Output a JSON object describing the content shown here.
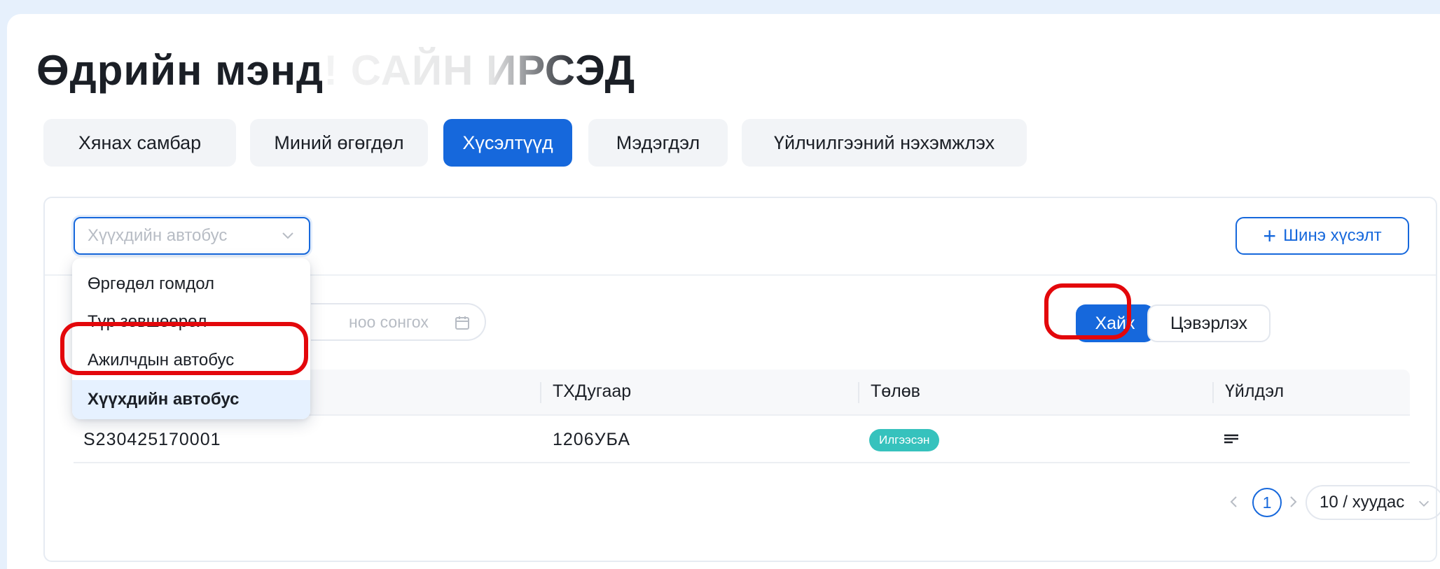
{
  "page": {
    "title_visible": "Өдрийн мэнд",
    "title_faded": "! САЙН ИРСЭ",
    "title_tail": "Д"
  },
  "tabs": [
    {
      "label": "Хянах самбар",
      "active": false
    },
    {
      "label": "Миний өгөгдөл",
      "active": false
    },
    {
      "label": "Хүсэлтүүд",
      "active": true
    },
    {
      "label": "Мэдэгдэл",
      "active": false
    },
    {
      "label": "Үйлчилгээний нэхэмжлэх",
      "active": false
    }
  ],
  "filters": {
    "type_select": {
      "placeholder": "Хүүхдийн автобус",
      "icon": "chevron-down-icon"
    },
    "date_field": {
      "placeholder": "ноо сонгох",
      "icon": "calendar-icon"
    },
    "search_label": "Хайх",
    "clear_label": "Цэвэрлэх"
  },
  "new_request": {
    "icon": "plus-icon",
    "label": "Шинэ хүсэлт"
  },
  "dropdown": {
    "options": [
      {
        "label": "Өргөдөл гомдол",
        "selected": false,
        "highlighted": false
      },
      {
        "label": "Түр зөвшөөрөл",
        "selected": false,
        "highlighted": false
      },
      {
        "label": "Ажилчдын автобус",
        "selected": false,
        "highlighted": true
      },
      {
        "label": "Хүүхдийн автобус",
        "selected": true,
        "highlighted": false
      }
    ]
  },
  "table": {
    "columns": [
      "",
      "ТХДугаар",
      "Төлөв",
      "Үйлдэл"
    ],
    "rows": [
      {
        "id": "S230425170001",
        "plate": "1206УБА",
        "status": "Илгээсэн",
        "action_icon": "menu-icon"
      }
    ]
  },
  "pagination": {
    "current_page": "1",
    "page_size": "10 / хуудас"
  },
  "colors": {
    "primary": "#1668dc",
    "highlight_ring": "#e3070b",
    "status_sent": "#36c2bd",
    "background": "#e6f0fc"
  }
}
